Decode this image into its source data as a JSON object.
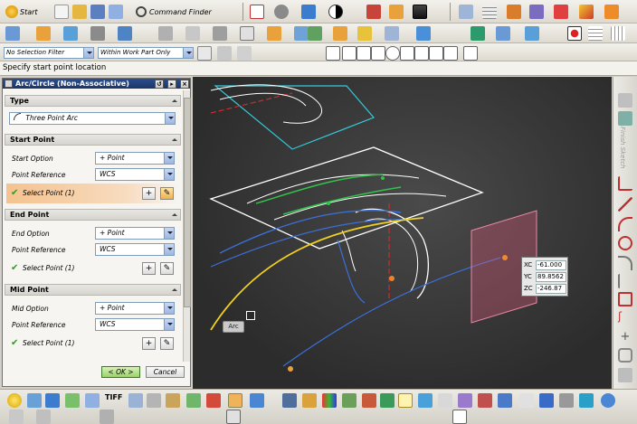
{
  "toolbar": {
    "start_label": "Start",
    "command_finder_label": "Command Finder"
  },
  "filter_bar": {
    "selection_filter": "No Selection Filter",
    "scope_filter": "Within Work Part Only"
  },
  "status": {
    "prompt": "Specify start point location"
  },
  "dialog": {
    "title": "Arc/Circle (Non-Associative)",
    "type_section": "Type",
    "type_value": "Three Point Arc",
    "start_point": {
      "header": "Start Point",
      "option_label": "Start Option",
      "option_value": "Point",
      "reference_label": "Point Reference",
      "reference_value": "WCS",
      "select_label": "Select Point (1)"
    },
    "end_point": {
      "header": "End Point",
      "option_label": "End Option",
      "option_value": "Point",
      "reference_label": "Point Reference",
      "reference_value": "WCS",
      "select_label": "Select Point (1)"
    },
    "mid_point": {
      "header": "Mid Point",
      "option_label": "Mid Option",
      "option_value": "Point",
      "reference_label": "Point Reference",
      "reference_value": "WCS",
      "select_label": "Select Point (1)"
    },
    "ok_label": "< OK >",
    "cancel_label": "Cancel"
  },
  "viewport": {
    "arc_tag": "Arc",
    "coords": {
      "xc_label": "XC",
      "xc_value": "-61.000",
      "yc_label": "YC",
      "yc_value": "89.8562",
      "zc_label": "ZC",
      "zc_value": "-246.87"
    }
  },
  "right_bar": {
    "search_label": "Finish Sketch"
  },
  "colors": {
    "viewport_bg": "#3a3a3a",
    "title_bar": "#1c3566",
    "active_row": "#f5c28f",
    "ok_green": "#9ad36a"
  }
}
